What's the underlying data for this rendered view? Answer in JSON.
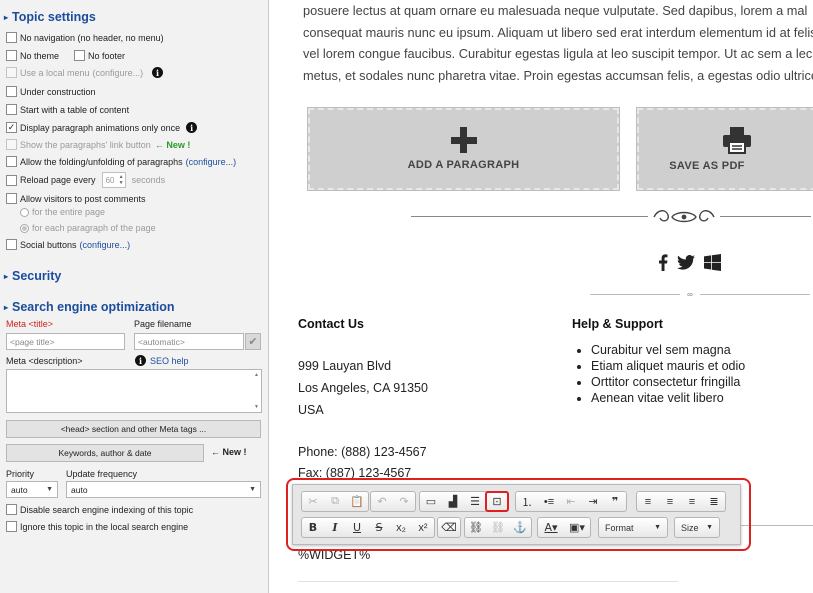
{
  "topic_settings": {
    "title": "Topic settings",
    "no_navigation": "No navigation (no header, no menu)",
    "no_theme": "No theme",
    "no_footer": "No footer",
    "use_local_menu": "Use a local menu",
    "configure_paren": "(configure...)",
    "under_construction": "Under construction",
    "start_toc": "Start with a table of content",
    "display_animations": "Display paragraph animations only once",
    "show_link_button": "Show the paragraphs' link button",
    "new_label": "New !",
    "new_arrow": "←",
    "allow_folding": "Allow the folding/unfolding of paragraphs",
    "reload_every": "Reload page every",
    "reload_value": "60",
    "seconds": "seconds",
    "allow_comments": "Allow visitors to post comments",
    "for_entire_page": "for the entire page",
    "for_each_paragraph": "for each paragraph of the page",
    "social_buttons": "Social buttons",
    "info_glyph": "i"
  },
  "security": {
    "title": "Security"
  },
  "seo": {
    "title": "Search engine optimization",
    "meta_title_label": "Meta <title>",
    "page_filename_label": "Page filename",
    "meta_title_placeholder": "<page title>",
    "page_filename_placeholder": "<automatic>",
    "meta_description_label": "Meta <description>",
    "seo_help": "SEO help",
    "head_section_button": "<head> section and other Meta tags ...",
    "keywords_button": "Keywords, author & date",
    "priority_label": "Priority",
    "update_frequency_label": "Update frequency",
    "priority_value": "auto",
    "update_frequency_value": "auto",
    "disable_indexing": "Disable search engine indexing of this topic",
    "ignore_local_search": "Ignore this topic in the local search engine"
  },
  "content": {
    "lorem_lines": [
      "posuere lectus at quam ornare eu malesuada neque vulputate. Sed dapibus, lorem a mal",
      "consequat mauris nunc eu ipsum. Aliquam ut libero sed erat interdum elementum id at felis",
      "vel lorem congue faucibus. Curabitur egestas ligula at leo suscipit tempor. Ut ac sem a lec",
      "metus, et sodales nunc pharetra vitae. Proin egestas accumsan felis, a egestas odio ultrices"
    ],
    "add_paragraph": "ADD A PARAGRAPH",
    "save_as_pdf": "SAVE AS PDF",
    "contact_title": "Contact Us",
    "address_1": "999 Lauyan Blvd",
    "address_2": "Los Angeles, CA 91350",
    "address_3": "USA",
    "phone": "Phone: (888) 123-4567",
    "fax": "Fax: (887) 123-4567",
    "help_title": "Help & Support",
    "help_items": [
      "Curabitur vel sem magna",
      "Etiam aliquet mauris et odio",
      "Orttitor consectetur fringilla",
      "Aenean vitae velit libero"
    ],
    "widget": "%WIDGET%",
    "divider_glyph": "∞"
  },
  "toolbar": {
    "format_label": "Format",
    "size_label": "Size",
    "highlight_color": "#e02020"
  },
  "colors": {
    "section_title": "#1b4d9c",
    "new_badge": "#2a9a2a",
    "highlight": "#e02020"
  }
}
